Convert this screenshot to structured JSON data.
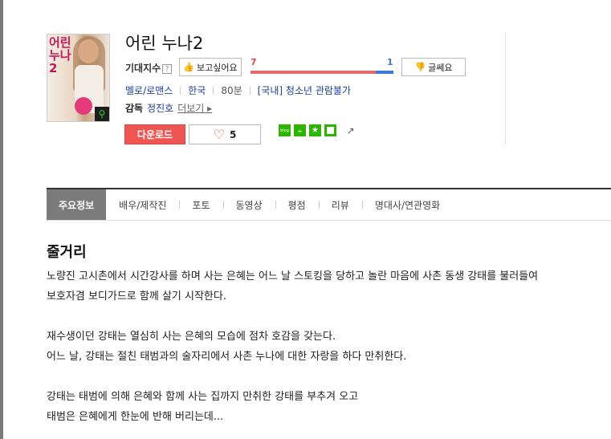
{
  "movie": {
    "title": "어린 누나2",
    "poster_title": "어린 누나2"
  },
  "expectation": {
    "label": "기대지수",
    "help": "?",
    "like_label": "보고싶어요",
    "dislike_label": "글쎄요",
    "like_count": "7",
    "dislike_count": "1",
    "like_ratio": 0.875
  },
  "meta": {
    "genre": "멜로/로맨스",
    "country": "한국",
    "runtime": "80분",
    "rating": "[국내] 청소년 관람불가"
  },
  "director": {
    "label": "감독",
    "name": "정진호",
    "more": "더보기"
  },
  "actions": {
    "download": "다운로드",
    "heart_count": "5"
  },
  "share": {
    "blog": "blog"
  },
  "tabs": [
    {
      "label": "주요정보"
    },
    {
      "label": "배우/제작진"
    },
    {
      "label": "포토"
    },
    {
      "label": "동영상"
    },
    {
      "label": "평점"
    },
    {
      "label": "리뷰"
    },
    {
      "label": "명대사/연관영화"
    }
  ],
  "synopsis": {
    "title": "줄거리",
    "lines": [
      "노량진 고시촌에서 시간강사를 하며 사는 은혜는 어느 날 스토킹을 당하고 놀란 마음에 사촌 동생 강태를 불러들여",
      "보호자겸 보디가드로 함께 살기 시작한다.",
      "",
      " 재수생이던 강태는 열심히 사는 은혜의 모습에 점차 호감을 갖는다.",
      " 어느 날, 강태는 절친 태범과의 술자리에서 사촌 누나에 대한 자랑을 하다 만취한다.",
      "",
      " 강태는 태범에 의해 은혜와 함께 사는 집까지 만취한 강태를 부추겨 오고",
      " 태범은 은혜에게 한눈에 반해 버리는데..."
    ]
  }
}
